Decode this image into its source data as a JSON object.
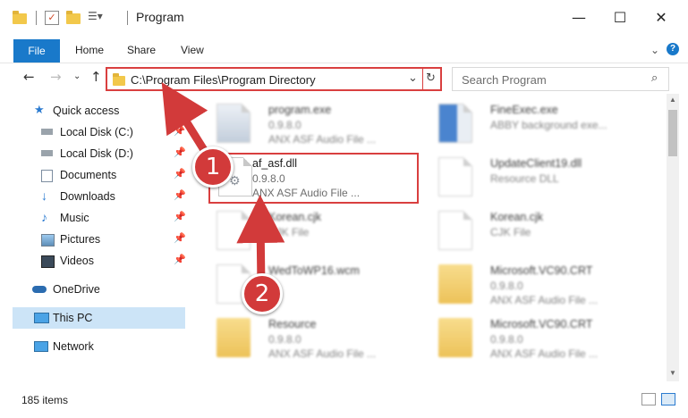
{
  "window": {
    "title": "Program",
    "minimize": "—",
    "maximize": "☐",
    "close": "✕"
  },
  "ribbon": {
    "tabs": [
      "File",
      "Home",
      "Share",
      "View"
    ]
  },
  "address": {
    "path": "C:\\Program Files\\Program Directory",
    "search_placeholder": "Search Program"
  },
  "sidebar": {
    "items": [
      {
        "label": "Quick access",
        "icon": "star-icon"
      },
      {
        "label": "Local Disk (C:)",
        "icon": "drive-icon",
        "pinned": true
      },
      {
        "label": "Local Disk (D:)",
        "icon": "drive-icon",
        "pinned": true
      },
      {
        "label": "Documents",
        "icon": "documents-icon",
        "pinned": true
      },
      {
        "label": "Downloads",
        "icon": "download-icon",
        "pinned": true
      },
      {
        "label": "Music",
        "icon": "music-icon",
        "pinned": true
      },
      {
        "label": "Pictures",
        "icon": "pictures-icon",
        "pinned": true
      },
      {
        "label": "Videos",
        "icon": "videos-icon",
        "pinned": true
      },
      {
        "label": "OneDrive",
        "icon": "cloud-icon"
      },
      {
        "label": "This PC",
        "icon": "computer-icon",
        "selected": true
      },
      {
        "label": "Network",
        "icon": "network-icon"
      }
    ]
  },
  "files": [
    {
      "name": "program.exe",
      "line2": "0.9.8.0",
      "line3": "ANX ASF Audio File ...",
      "icon": "exe-icon"
    },
    {
      "name": "FineExec.exe",
      "line2": "ABBY background exe...",
      "line3": "",
      "icon": "exe-icon"
    },
    {
      "name": "af_asf.dll",
      "line2": "0.9.8.0",
      "line3": "ANX ASF Audio File ...",
      "icon": "dll-icon"
    },
    {
      "name": "UpdateClient19.dll",
      "line2": "Resource DLL",
      "line3": "",
      "icon": "dll-icon"
    },
    {
      "name": "Korean.cjk",
      "line2": "CJK File",
      "line3": "",
      "icon": "document-icon"
    },
    {
      "name": "Korean.cjk",
      "line2": "CJK File",
      "line3": "",
      "icon": "document-icon"
    },
    {
      "name": "WedToWP16.wcm",
      "line2": "",
      "line3": "",
      "icon": "document-icon"
    },
    {
      "name": "Microsoft.VC90.CRT",
      "line2": "0.9.8.0",
      "line3": "ANX ASF Audio File ...",
      "icon": "folder-icon"
    },
    {
      "name": "Resource",
      "line2": "0.9.8.0",
      "line3": "ANX ASF Audio File ...",
      "icon": "folder-icon"
    },
    {
      "name": "Microsoft.VC90.CRT",
      "line2": "0.9.8.0",
      "line3": "ANX ASF Audio File ...",
      "icon": "folder-icon"
    }
  ],
  "annotations": {
    "step1": "1",
    "step2": "2",
    "color": "#d23a3a"
  },
  "status": {
    "items": "185 items"
  }
}
